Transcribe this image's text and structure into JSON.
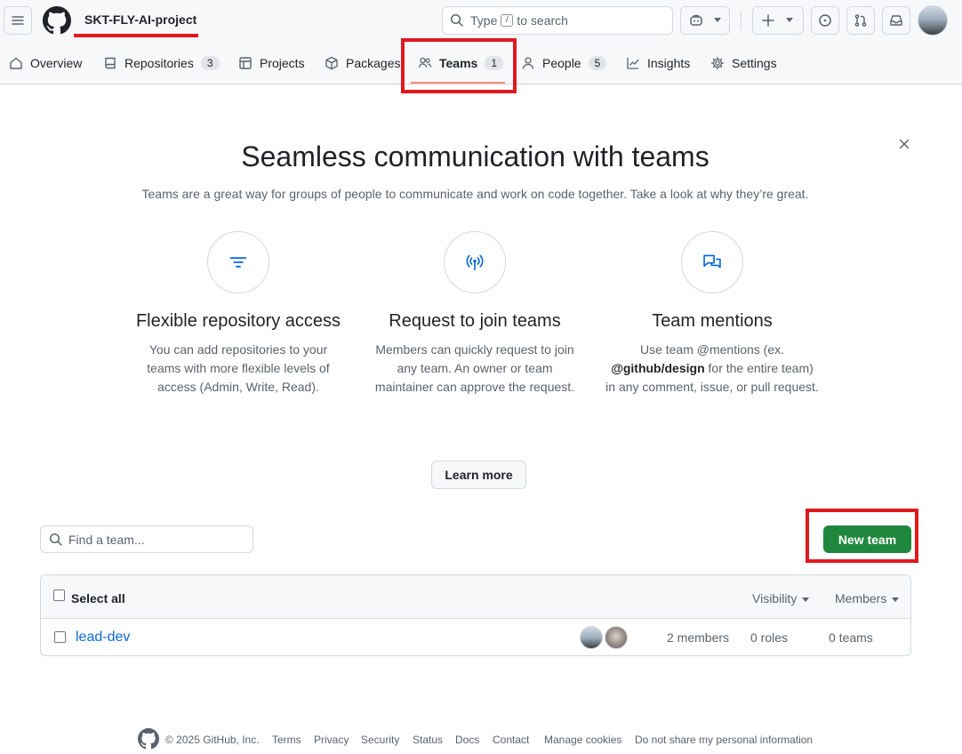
{
  "header": {
    "org_name": "SKT-FLY-AI-project",
    "search_placeholder_pre": "Type",
    "search_key": "/",
    "search_placeholder_post": "to search"
  },
  "nav": {
    "overview": "Overview",
    "repositories": "Repositories",
    "repositories_count": "3",
    "projects": "Projects",
    "packages": "Packages",
    "teams": "Teams",
    "teams_count": "1",
    "people": "People",
    "people_count": "5",
    "insights": "Insights",
    "settings": "Settings"
  },
  "hero": {
    "title": "Seamless communication with teams",
    "subtitle": "Teams are a great way for groups of people to communicate and work on code together. Take a look at why they’re great.",
    "features": [
      {
        "title": "Flexible repository access",
        "description": "You can add repositories to your teams with more flexible levels of access (Admin, Write, Read)."
      },
      {
        "title": "Request to join teams",
        "description": "Members can quickly request to join any team. An owner or team maintainer can approve the request."
      },
      {
        "title": "Team mentions",
        "description_pre": "Use team @mentions (ex.",
        "description_bold": "@github/design",
        "description_post": "for the entire team) in any comment, issue, or pull request."
      }
    ],
    "learn_more": "Learn more"
  },
  "teams_list": {
    "search_placeholder": "Find a team...",
    "new_team": "New team",
    "select_all": "Select all",
    "visibility": "Visibility",
    "members": "Members",
    "rows": [
      {
        "name": "lead-dev",
        "members": "2 members",
        "roles": "0 roles",
        "teams": "0 teams"
      }
    ]
  },
  "footer": {
    "copyright": "© 2025 GitHub, Inc.",
    "links": [
      "Terms",
      "Privacy",
      "Security",
      "Status",
      "Docs",
      "Contact",
      "Manage cookies",
      "Do not share my personal information"
    ]
  },
  "colors": {
    "accent_green": "#1f883d",
    "link_blue": "#0969da",
    "annotation_red": "#e0191f",
    "tab_underline": "#fd8c73"
  }
}
